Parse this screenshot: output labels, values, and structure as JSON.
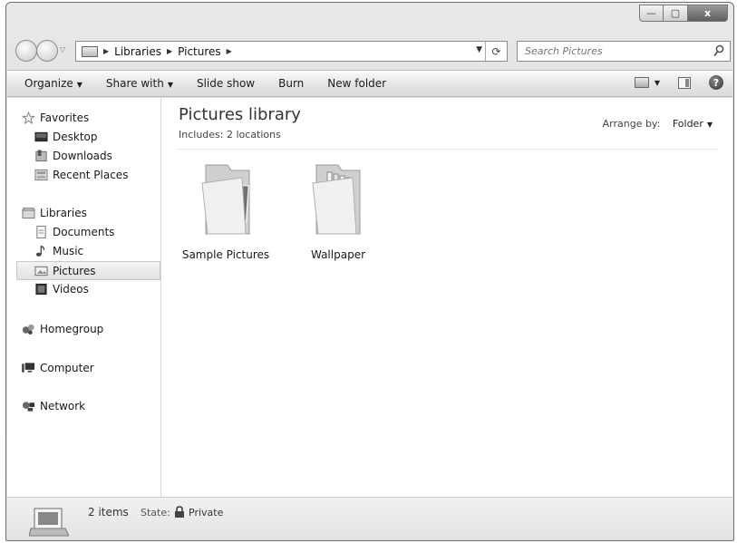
{
  "window": {
    "controls": {
      "minimize": "—",
      "maximize": "▢",
      "close": "x"
    }
  },
  "address": {
    "crumbs": [
      "Libraries",
      "Pictures"
    ],
    "search_placeholder": "Search Pictures"
  },
  "toolbar": {
    "organize": "Organize",
    "share_with": "Share with",
    "slide_show": "Slide show",
    "burn": "Burn",
    "new_folder": "New folder",
    "help": "?"
  },
  "nav": {
    "favorites": {
      "label": "Favorites",
      "items": [
        "Desktop",
        "Downloads",
        "Recent Places"
      ]
    },
    "libraries": {
      "label": "Libraries",
      "items": [
        "Documents",
        "Music",
        "Pictures",
        "Videos"
      ],
      "selected": "Pictures"
    },
    "homegroup": "Homegroup",
    "computer": "Computer",
    "network": "Network"
  },
  "content": {
    "title": "Pictures library",
    "includes": "Includes:",
    "locations": "2 locations",
    "arrange_label": "Arrange by:",
    "arrange_value": "Folder",
    "folders": [
      "Sample Pictures",
      "Wallpaper"
    ]
  },
  "status": {
    "count": "2 items",
    "state_label": "State:",
    "state_value": "Private"
  }
}
